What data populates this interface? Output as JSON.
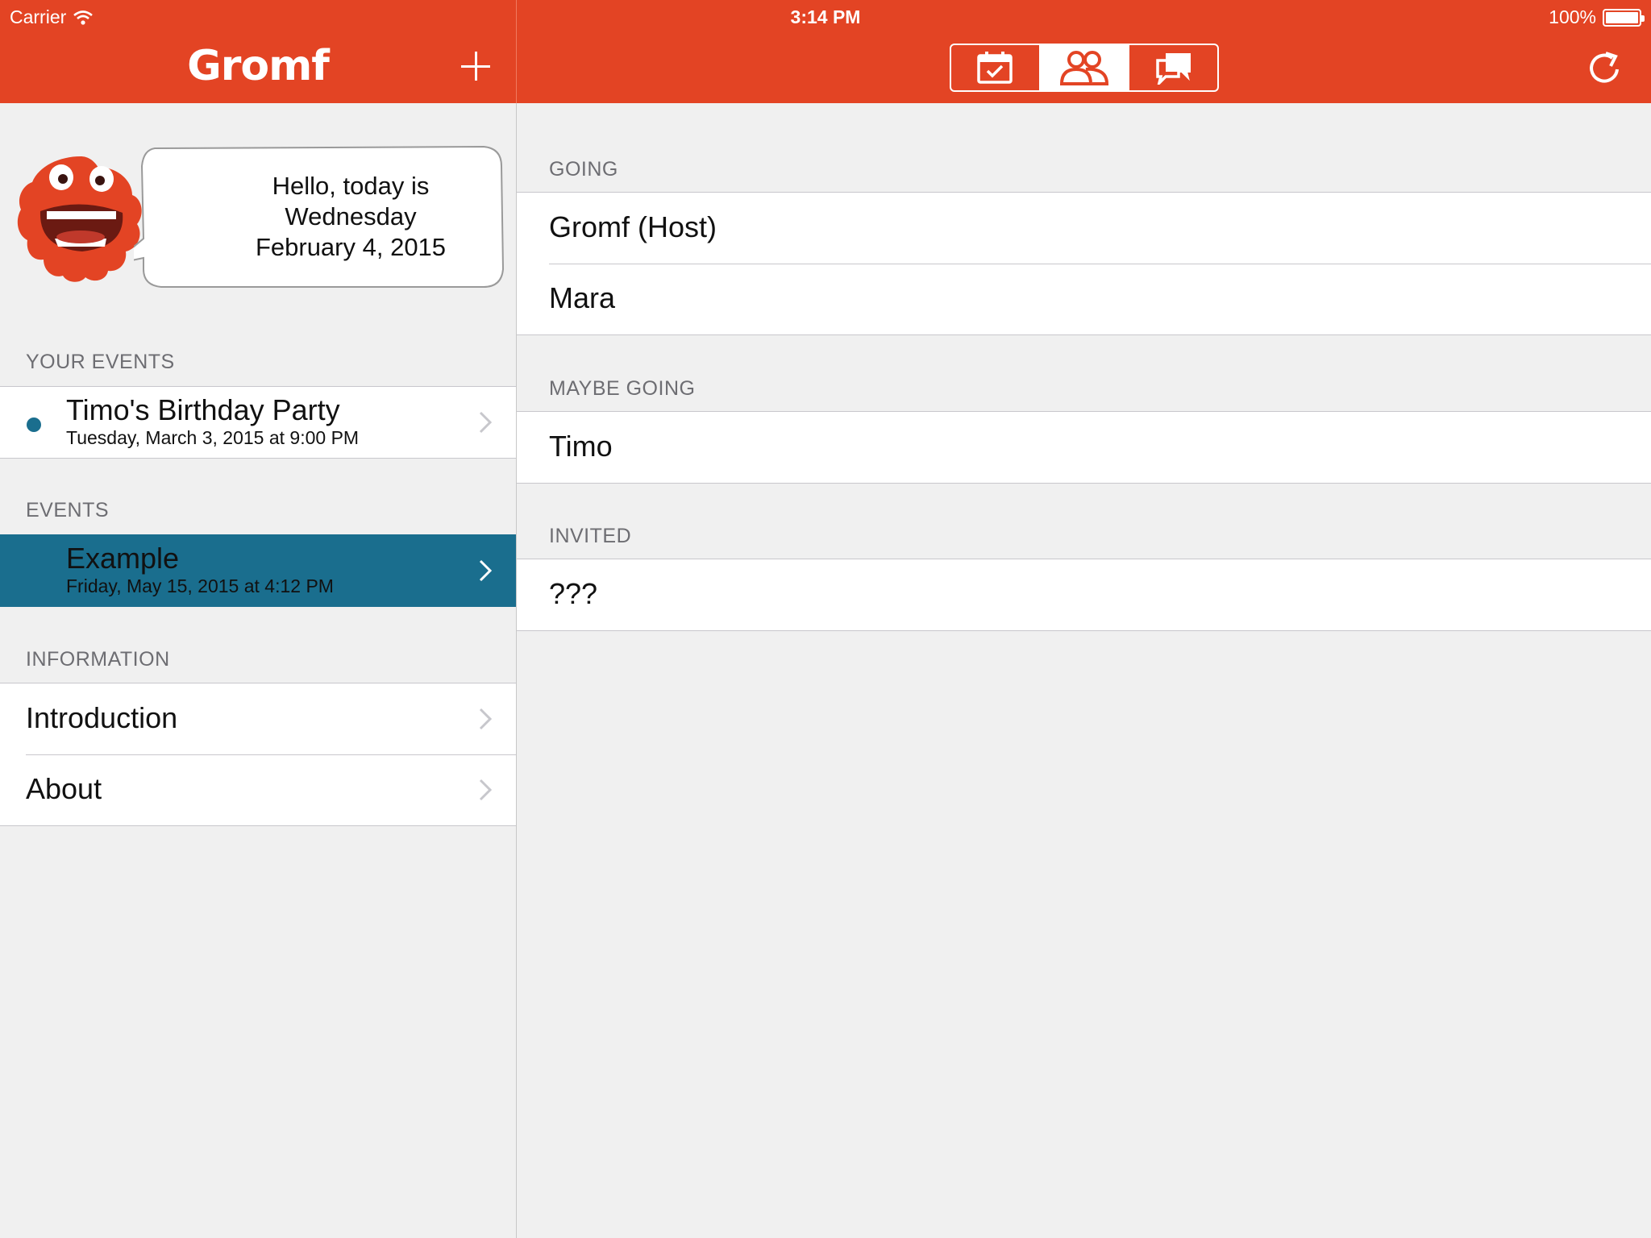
{
  "status_bar": {
    "carrier": "Carrier",
    "time": "3:14 PM",
    "battery": "100%",
    "battery_level": 1.0
  },
  "nav": {
    "brand": "Gromf",
    "add_icon": "plus-icon",
    "tabs": [
      {
        "icon": "calendar-check-icon",
        "active": false
      },
      {
        "icon": "people-icon",
        "active": true
      },
      {
        "icon": "chat-bubbles-icon",
        "active": false
      }
    ],
    "refresh_icon": "refresh-icon"
  },
  "colors": {
    "brand": "#e34424",
    "selection": "#1a6e8e"
  },
  "sidebar": {
    "greeting": {
      "line1": "Hello, today is",
      "line2": "Wednesday",
      "line3": "February 4, 2015"
    },
    "your_events": {
      "header": "YOUR EVENTS",
      "items": [
        {
          "title": "Timo's Birthday Party",
          "subtitle": "Tuesday, March 3, 2015 at 9:00 PM"
        }
      ]
    },
    "events": {
      "header": "EVENTS",
      "items": [
        {
          "title": "Example",
          "subtitle": "Friday, May 15, 2015 at 4:12 PM",
          "selected": true
        }
      ]
    },
    "information": {
      "header": "INFORMATION",
      "items": [
        {
          "label": "Introduction"
        },
        {
          "label": "About"
        }
      ]
    }
  },
  "detail": {
    "going": {
      "header": "GOING",
      "people": [
        "Gromf (Host)",
        "Mara"
      ]
    },
    "maybe_going": {
      "header": "MAYBE GOING",
      "people": [
        "Timo"
      ]
    },
    "invited": {
      "header": "INVITED",
      "people": [
        "???"
      ]
    }
  }
}
